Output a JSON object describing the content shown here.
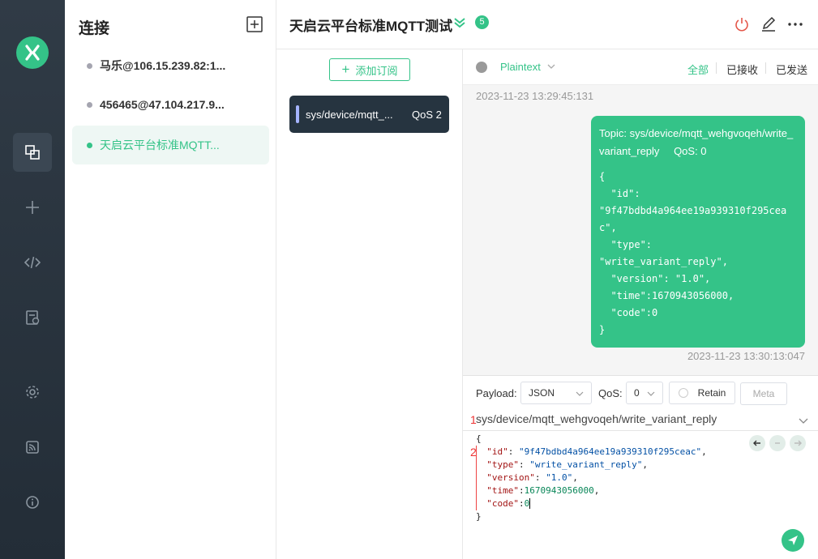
{
  "colors": {
    "accent": "#34c388",
    "rail": "#2b3640",
    "sub_item_bg": "#263440"
  },
  "rail": {
    "logo": "mqttx-logo",
    "items": [
      {
        "icon": "connections-icon",
        "active": true
      },
      {
        "icon": "plus-icon"
      },
      {
        "icon": "code-icon"
      },
      {
        "icon": "log-icon"
      },
      {
        "icon": "gear-icon"
      },
      {
        "icon": "rss-icon"
      },
      {
        "icon": "info-icon"
      }
    ]
  },
  "connections": {
    "title": "连接",
    "items": [
      {
        "label": "马乐@106.15.239.82:1...",
        "active": false
      },
      {
        "label": "456465@47.104.217.9...",
        "active": false
      },
      {
        "label": "天启云平台标准MQTT...",
        "active": true
      }
    ]
  },
  "header": {
    "title": "天启云平台标准MQTT测试",
    "badge": "5"
  },
  "subscriptions": {
    "add_label": "添加订阅",
    "items": [
      {
        "topic": "sys/device/mqtt_...",
        "qos": "QoS 2"
      }
    ]
  },
  "messages": {
    "format": "Plaintext",
    "tabs": {
      "all": "全部",
      "received": "已接收",
      "sent": "已发送"
    },
    "prev_timestamp": "2023-11-23 13:29:45:131",
    "last": {
      "topic_prefix": "Topic:",
      "topic": "sys/device/mqtt_wehgvoqeh/write_variant_reply",
      "qos": "QoS: 0",
      "body": "{\n  \"id\":\n\"9f47bdbd4a964ee19a939310f295ceac\",\n  \"type\":\n\"write_variant_reply\",\n  \"version\": \"1.0\",\n  \"time\":1670943056000,\n  \"code\":0\n}",
      "timestamp": "2023-11-23 13:30:13:047"
    }
  },
  "compose": {
    "payload_label": "Payload:",
    "payload_format": "JSON",
    "qos_label": "QoS:",
    "qos_value": "0",
    "retain_label": "Retain",
    "meta_label": "Meta",
    "topic": "sys/device/mqtt_wehgvoqeh/write_variant_reply",
    "line_numbers": [
      "1",
      "2"
    ],
    "code": {
      "open": "{",
      "id_key": "\"id\"",
      "id_val": "\"9f47bdbd4a964ee19a939310f295ceac\"",
      "type_key": "\"type\"",
      "type_val": "\"write_variant_reply\"",
      "version_key": "\"version\"",
      "version_val": "\"1.0\"",
      "time_key": "\"time\"",
      "time_val": "1670943056000",
      "code_key": "\"code\"",
      "code_val": "0",
      "close": "}"
    }
  }
}
